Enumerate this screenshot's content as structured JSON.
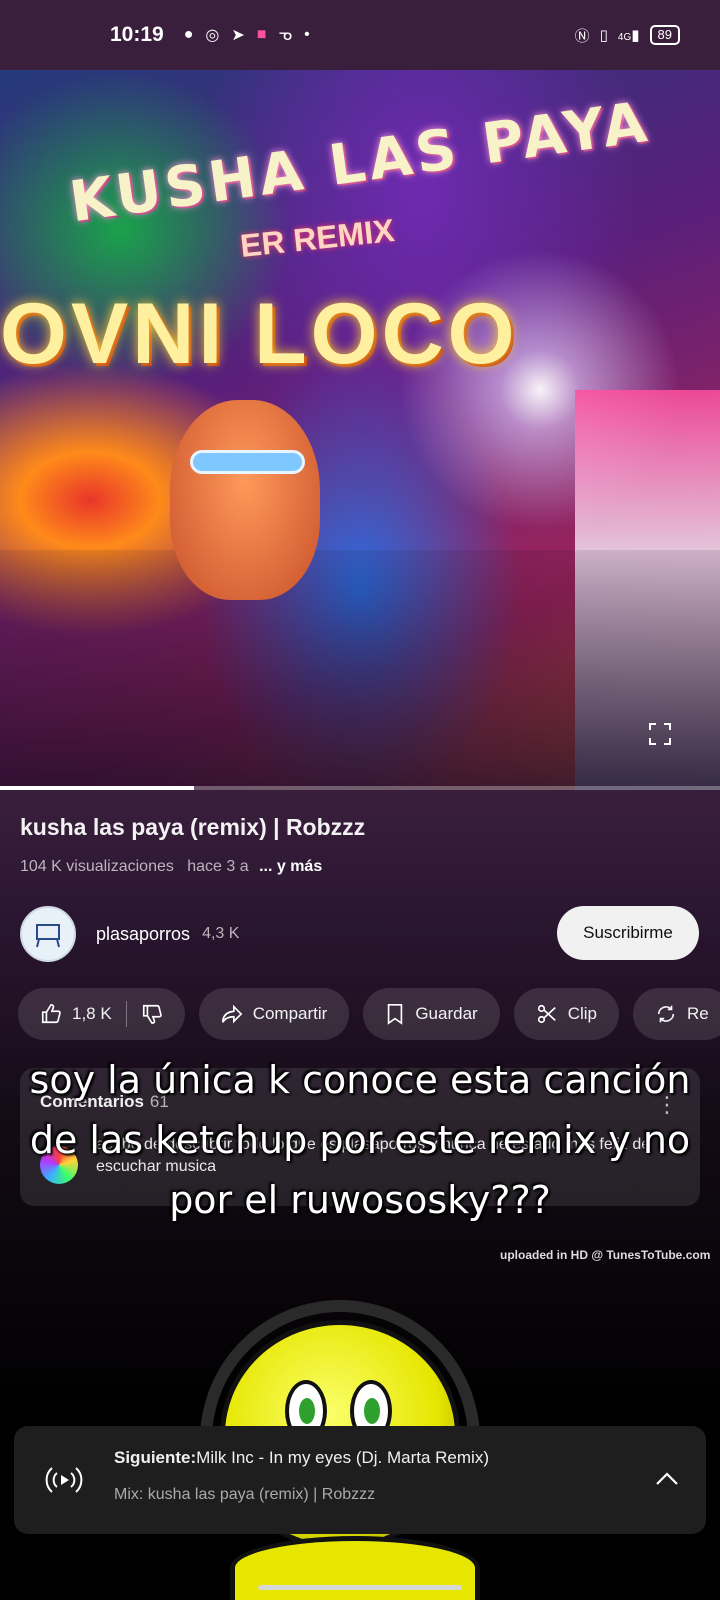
{
  "status_bar": {
    "time": "10:19",
    "battery": "89",
    "network": "4G"
  },
  "video": {
    "art_title": "KUSHA LAS PAYA",
    "art_subtitle": "ER REMIX",
    "art_logo": "OVNI LOCO",
    "progress_fraction": 0.27
  },
  "details": {
    "title": "kusha las paya (remix) | Robzzz",
    "views": "104 K visualizaciones",
    "age": "hace 3 a",
    "more": "... y más"
  },
  "channel": {
    "name": "plasaporros",
    "subscribers": "4,3 K",
    "subscribe_label": "Suscribirme"
  },
  "actions": {
    "likes": "1,8 K",
    "share": "Compartir",
    "save": "Guardar",
    "clip": "Clip",
    "remix": "Re"
  },
  "comments": {
    "label": "Comentarios",
    "count": "61",
    "top_comment": "acabo de descubrir todo lo que es plasaporros y nunca he estado más feliz de escuchar musica"
  },
  "overlay": {
    "caption": "soy la única k conoce esta canción de las ketchup por este remix y no por el ruwososky???"
  },
  "watermark": "uploaded in HD @ TunesToTube.com",
  "up_next": {
    "prefix": "Siguiente:",
    "title": "Milk Inc - In my eyes (Dj. Marta Remix)",
    "mix": "Mix: kusha las paya (remix) | Robzzz"
  }
}
